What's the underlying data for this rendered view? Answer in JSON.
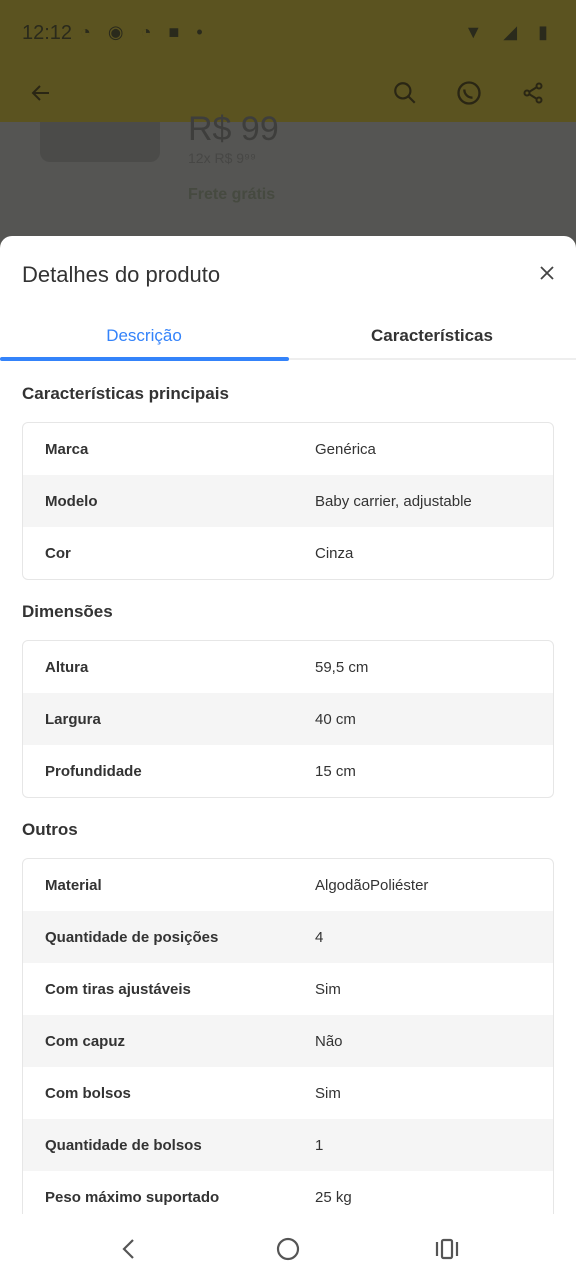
{
  "status_bar": {
    "time": "12:12",
    "apps": "◔ ◉ ◔ ■ •",
    "right": "▼ ◢ ▮"
  },
  "background": {
    "price": "R$ 99",
    "installments": "12x R$ 9⁹⁹",
    "shipping": "Frete grátis"
  },
  "sheet": {
    "title": "Detalhes do produto",
    "tabs": [
      {
        "label": "Descrição",
        "active": true
      },
      {
        "label": "Características",
        "active": false
      }
    ]
  },
  "sections": [
    {
      "title": "Características principais",
      "rows": [
        {
          "key": "Marca",
          "value": "Genérica"
        },
        {
          "key": "Modelo",
          "value": "Baby carrier, adjustable"
        },
        {
          "key": "Cor",
          "value": "Cinza"
        }
      ]
    },
    {
      "title": "Dimensões",
      "rows": [
        {
          "key": "Altura",
          "value": "59,5 cm"
        },
        {
          "key": "Largura",
          "value": "40 cm"
        },
        {
          "key": "Profundidade",
          "value": "15 cm"
        }
      ]
    },
    {
      "title": "Outros",
      "rows": [
        {
          "key": "Material",
          "value": "AlgodãoPoliéster"
        },
        {
          "key": "Quantidade de posições",
          "value": "4"
        },
        {
          "key": "Com tiras ajustáveis",
          "value": "Sim"
        },
        {
          "key": "Com capuz",
          "value": "Não"
        },
        {
          "key": "Com bolsos",
          "value": "Sim"
        },
        {
          "key": "Quantidade de bolsos",
          "value": "1"
        },
        {
          "key": "Peso máximo suportado",
          "value": "25 kg"
        }
      ]
    }
  ],
  "colors": {
    "accent": "#3483fa",
    "brand_yellow": "#fff159"
  },
  "icons": {
    "back": "arrow-left-icon",
    "search": "search-icon",
    "whatsapp": "whatsapp-icon",
    "share": "share-icon",
    "close": "close-icon",
    "nav_back": "chevron-left-icon",
    "nav_home": "circle-home-icon",
    "nav_recents": "recents-icon"
  }
}
